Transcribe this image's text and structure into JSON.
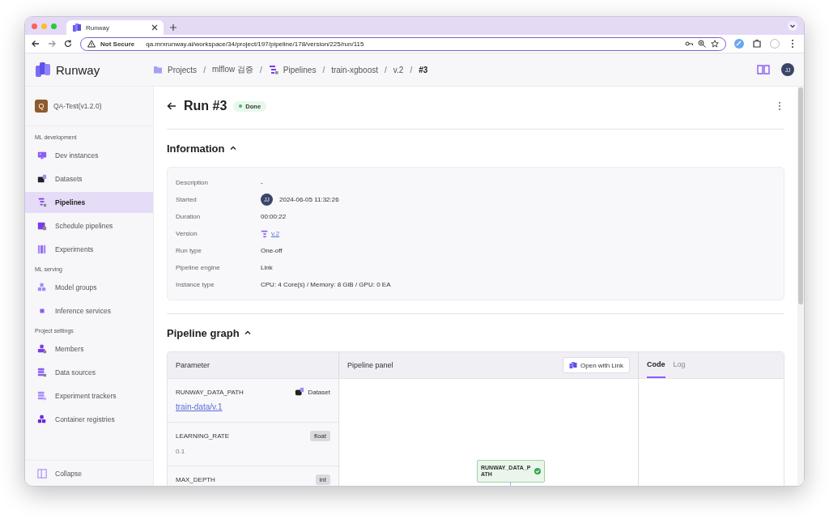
{
  "browser": {
    "tab_title": "Runway",
    "security": "Not Secure",
    "url": "qa.mrxrunway.ai/workspace/34/project/197/pipeline/178/version/225/run/115"
  },
  "header": {
    "logo": "Runway",
    "breadcrumb_separator": "/",
    "breadcrumb": [
      {
        "label": "Projects",
        "kind": "folder",
        "current": false
      },
      {
        "label": "mlflow 검증",
        "kind": "plain",
        "current": false
      },
      {
        "label": "Pipelines",
        "kind": "pipeline",
        "current": false
      },
      {
        "label": "train-xgboost",
        "kind": "plain",
        "current": false
      },
      {
        "label": "v.2",
        "kind": "plain",
        "current": false
      },
      {
        "label": "#3",
        "kind": "plain",
        "current": true
      }
    ],
    "user_initials": "JJ"
  },
  "sidebar": {
    "project": {
      "initial": "Q",
      "name": "QA-Test(v1.2.0)"
    },
    "sections": [
      {
        "title": "ML development",
        "items": [
          {
            "label": "Dev instances",
            "selected": false
          },
          {
            "label": "Datasets",
            "selected": false
          },
          {
            "label": "Pipelines",
            "selected": true
          },
          {
            "label": "Schedule pipelines",
            "selected": false
          },
          {
            "label": "Experiments",
            "selected": false
          }
        ]
      },
      {
        "title": "ML serving",
        "items": [
          {
            "label": "Model groups",
            "selected": false
          },
          {
            "label": "Inference services",
            "selected": false
          }
        ]
      },
      {
        "title": "Project settings",
        "items": [
          {
            "label": "Members",
            "selected": false
          },
          {
            "label": "Data sources",
            "selected": false
          },
          {
            "label": "Experiment trackers",
            "selected": false
          },
          {
            "label": "Container registries",
            "selected": false
          }
        ]
      }
    ],
    "collapse": "Collapse"
  },
  "run": {
    "title": "Run #3",
    "status": "Done"
  },
  "information": {
    "heading": "Information",
    "expanded": true,
    "rows": [
      {
        "label": "Description",
        "value": "-",
        "kind": "text"
      },
      {
        "label": "Started",
        "value": "2024-06-05 11:32:26",
        "kind": "user",
        "avatar": "JJ"
      },
      {
        "label": "Duration",
        "value": "00:00:22",
        "kind": "text"
      },
      {
        "label": "Version",
        "value": "v.2",
        "kind": "link"
      },
      {
        "label": "Run type",
        "value": "One-off",
        "kind": "text"
      },
      {
        "label": "Pipeline engine",
        "value": "Link",
        "kind": "text"
      },
      {
        "label": "Instance type",
        "value": "CPU: 4 Core(s) / Memory: 8 GiB / GPU: 0 EA",
        "kind": "text"
      }
    ]
  },
  "pipeline_graph": {
    "heading": "Pipeline graph",
    "expanded": true,
    "parameter_panel": {
      "title": "Parameter",
      "params": [
        {
          "name": "RUNWAY_DATA_PATH",
          "type": "Dataset",
          "kind": "dataset",
          "value": "train-data/v.1"
        },
        {
          "name": "LEARNING_RATE",
          "type": "float",
          "kind": "typed",
          "value": "0.1"
        },
        {
          "name": "MAX_DEPTH",
          "type": "int",
          "kind": "typed"
        }
      ]
    },
    "pipeline_panel": {
      "title": "Pipeline panel",
      "button": "Open with Link",
      "node": {
        "label": "RUNWAY_DATA_PATH",
        "done": true
      }
    },
    "output_panel": {
      "tabs": [
        {
          "label": "Code",
          "selected": true
        },
        {
          "label": "Log",
          "selected": false
        }
      ]
    }
  }
}
